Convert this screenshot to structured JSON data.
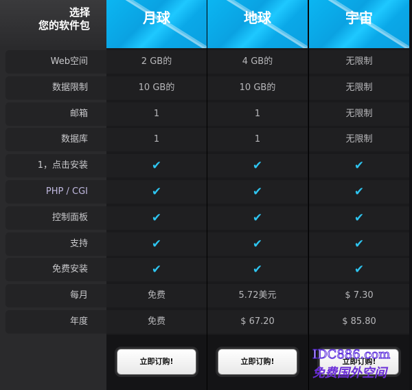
{
  "header": {
    "line1": "选择",
    "line2": "您的软件包"
  },
  "plans": [
    {
      "name": "月球"
    },
    {
      "name": "地球"
    },
    {
      "name": "宇宙"
    }
  ],
  "rows": [
    {
      "label": "Web空间",
      "values": [
        "2 GB的",
        "4 GB的",
        "无限制"
      ]
    },
    {
      "label": "数据限制",
      "values": [
        "10 GB的",
        "10 GB的",
        "无限制"
      ]
    },
    {
      "label": "邮箱",
      "values": [
        "1",
        "1",
        "无限制"
      ]
    },
    {
      "label": "数据库",
      "values": [
        "1",
        "1",
        "无限制"
      ]
    },
    {
      "label": "1，点击安装",
      "values": [
        "✔",
        "✔",
        "✔"
      ]
    },
    {
      "label": "PHP / CGI",
      "values": [
        "✔",
        "✔",
        "✔"
      ]
    },
    {
      "label": "控制面板",
      "values": [
        "✔",
        "✔",
        "✔"
      ]
    },
    {
      "label": "支持",
      "values": [
        "✔",
        "✔",
        "✔"
      ]
    },
    {
      "label": "免费安装",
      "values": [
        "✔",
        "✔",
        "✔"
      ]
    },
    {
      "label": "每月",
      "values": [
        "免费",
        "5.72美元",
        "$ 7.30"
      ]
    },
    {
      "label": "年度",
      "values": [
        "免费",
        "$ 67.20",
        "$ 85.80"
      ]
    }
  ],
  "order_label": "立即订购!",
  "watermark": {
    "line1": "IDC886.com",
    "line2": "免费国外空间"
  },
  "colors": {
    "accent": "#0bb6f2",
    "check": "#2ec4ef",
    "background": "#111114"
  }
}
